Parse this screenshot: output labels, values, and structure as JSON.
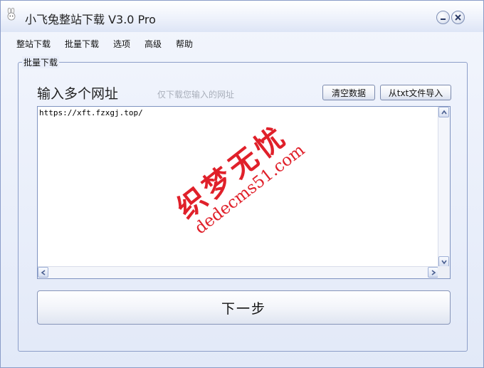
{
  "window": {
    "title": "小飞兔整站下载 V3.0 Pro",
    "icon": "rabbit-icon"
  },
  "titlebar_buttons": {
    "minimize_icon": "minimize-icon",
    "close_icon": "close-icon"
  },
  "menu": {
    "items": [
      "整站下载",
      "批量下载",
      "选项",
      "高级",
      "帮助"
    ]
  },
  "panel": {
    "group_title": "批量下载",
    "heading": "输入多个网址",
    "hint": "仅下载您输入的网址",
    "clear_button": "清空数据",
    "import_button": "从txt文件导入",
    "url_text": "https://xft.fzxgj.top/",
    "next_button": "下一步"
  },
  "watermark": {
    "cn": "织梦无忧",
    "en": "dedecms51.com",
    "color": "#e0202a"
  },
  "colors": {
    "window_bg": "#e2e9f8",
    "border": "#8c9ec9"
  }
}
